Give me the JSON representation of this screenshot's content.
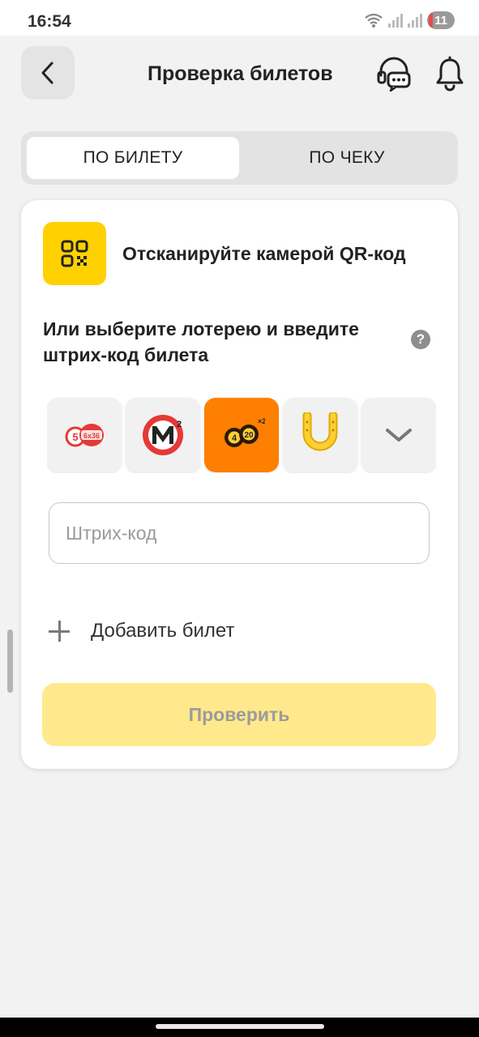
{
  "status": {
    "time": "16:54",
    "battery": "11"
  },
  "header": {
    "title": "Проверка билетов"
  },
  "tabs": [
    {
      "label": "ПО БИЛЕТУ",
      "active": true
    },
    {
      "label": "ПО ЧЕКУ",
      "active": false
    }
  ],
  "card": {
    "scan_text": "Отсканируйте камерой QR-код",
    "choose_text": "Или выберите лотерею и введите штрих-код билета",
    "help_glyph": "?",
    "lotteries": [
      {
        "icon": "bingo-balls-icon"
      },
      {
        "icon": "moscow-m2-icon"
      },
      {
        "icon": "balls-4-20-icon",
        "selected": true
      },
      {
        "icon": "horseshoe-icon"
      },
      {
        "icon": "chevron-down-icon"
      }
    ],
    "barcode": {
      "placeholder": "Штрих-код",
      "value": ""
    },
    "add_label": "Добавить билет",
    "check_label": "Проверить"
  },
  "colors": {
    "accent_yellow": "#ffd100",
    "selected_orange": "#ff7f00",
    "button_disabled": "#ffe98c"
  }
}
